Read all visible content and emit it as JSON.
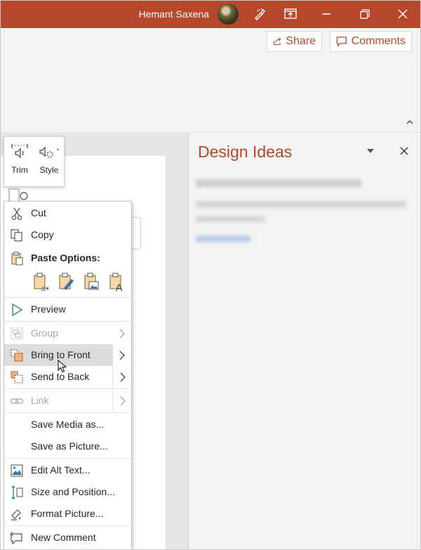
{
  "titlebar": {
    "user_name": "Hemant Saxena",
    "accent": "#b7472a",
    "icons": [
      "avatar",
      "pen-icon",
      "present-icon",
      "minimize-icon",
      "restore-icon",
      "close-icon"
    ]
  },
  "ribbon": {
    "share_label": "Share",
    "comments_label": "Comments"
  },
  "mini_toolbar": {
    "trim_label": "Trim",
    "style_label": "Style"
  },
  "design_ideas": {
    "title": "Design Ideas"
  },
  "context_menu": {
    "cut": "Cut",
    "copy": "Copy",
    "paste_options": "Paste Options:",
    "preview": "Preview",
    "group": "Group",
    "bring_to_front": "Bring to Front",
    "send_to_back": "Send to Back",
    "link": "Link",
    "save_media_as": "Save Media as...",
    "save_as_picture": "Save as Picture...",
    "edit_alt_text": "Edit Alt Text...",
    "size_and_position": "Size and Position...",
    "format_picture": "Format Picture...",
    "new_comment": "New Comment"
  }
}
